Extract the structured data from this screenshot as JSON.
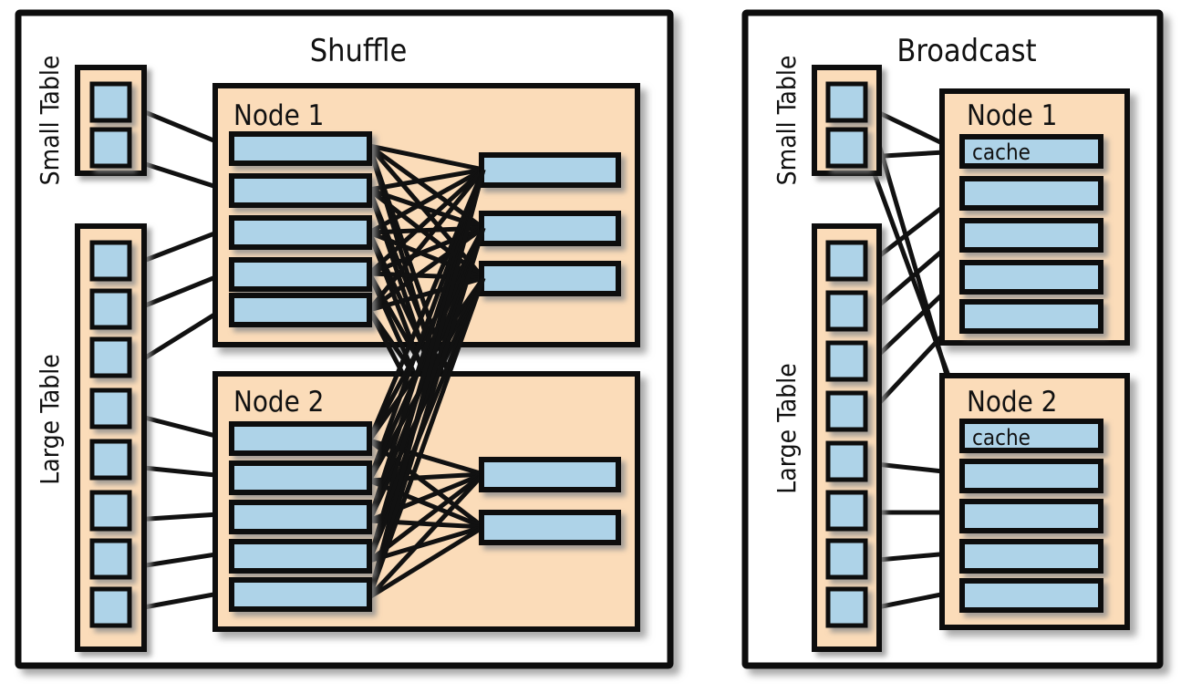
{
  "colors": {
    "panel_fill": "#ffffff",
    "group_fill": "#fbdcb9",
    "cell_fill": "#aed3e8",
    "stroke": "#111111",
    "shadow": "#b9b9b9",
    "text": "#111111"
  },
  "panels": [
    {
      "id": "shuffle",
      "title": "Shuffle",
      "tables": [
        {
          "id": "shuffle-small-table",
          "label": "Small Table",
          "cell_count": 2
        },
        {
          "id": "shuffle-large-table",
          "label": "Large Table",
          "cell_count": 8
        }
      ],
      "nodes": [
        {
          "id": "shuffle-node-1",
          "title": "Node 1",
          "input_bar_count": 5,
          "output_bar_count": 3,
          "input_bar_labels": [
            "",
            "",
            "",
            "",
            ""
          ],
          "output_bar_labels": [
            "",
            "",
            ""
          ]
        },
        {
          "id": "shuffle-node-2",
          "title": "Node 2",
          "input_bar_count": 5,
          "output_bar_count": 2,
          "input_bar_labels": [
            "",
            "",
            "",
            "",
            ""
          ],
          "output_bar_labels": [
            "",
            ""
          ]
        }
      ]
    },
    {
      "id": "broadcast",
      "title": "Broadcast",
      "tables": [
        {
          "id": "broadcast-small-table",
          "label": "Small Table",
          "cell_count": 2
        },
        {
          "id": "broadcast-large-table",
          "label": "Large Table",
          "cell_count": 8
        }
      ],
      "nodes": [
        {
          "id": "broadcast-node-1",
          "title": "Node 1",
          "input_bar_count": 5,
          "output_bar_count": 0,
          "input_bar_labels": [
            "cache",
            "",
            "",
            "",
            ""
          ],
          "output_bar_labels": []
        },
        {
          "id": "broadcast-node-2",
          "title": "Node 2",
          "input_bar_count": 5,
          "output_bar_count": 0,
          "input_bar_labels": [
            "cache",
            "",
            "",
            "",
            ""
          ],
          "output_bar_labels": []
        }
      ]
    }
  ],
  "labels": {
    "shuffle_title": "Shuffle",
    "broadcast_title": "Broadcast",
    "small_table": "Small Table",
    "large_table": "Large Table",
    "node_1": "Node 1",
    "node_2": "Node 2",
    "cache": "cache"
  }
}
